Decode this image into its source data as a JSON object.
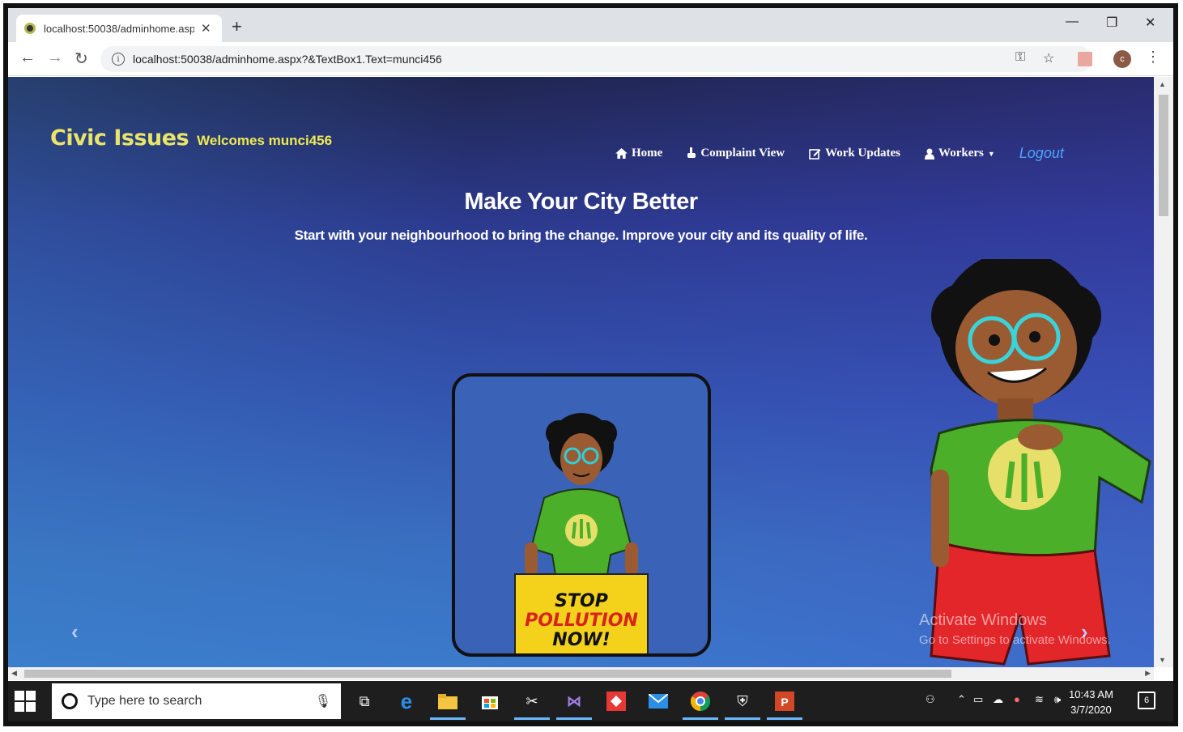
{
  "browser": {
    "tab_title": "localhost:50038/adminhome.aspx",
    "tab_close": "✕",
    "new_tab": "+",
    "url": "localhost:50038/adminhome.aspx?&TextBox1.Text=munci456",
    "profile_initial": "c",
    "window_controls": [
      "—",
      "❐",
      "✕"
    ],
    "nav": {
      "back": "←",
      "forward": "→",
      "reload": "↻"
    }
  },
  "page": {
    "brand_logo": "Civic Issues",
    "brand_welcome": "Welcomes munci456",
    "nav": {
      "home": "Home",
      "complaint_view": "Complaint View",
      "work_updates": "Work Updates",
      "workers": "Workers",
      "logout": "Logout"
    },
    "hero_title": "Make Your City Better",
    "hero_subtitle": "Start with your neighbourhood to bring the change. Improve your city and its quality of life.",
    "sign_line1": "STOP",
    "sign_line2": "POLLUTION",
    "sign_line3": "NOW!",
    "carousel_prev": "‹",
    "carousel_next": "›",
    "watermark_title": "Activate Windows",
    "watermark_sub": "Go to Settings to activate Windows."
  },
  "taskbar": {
    "search_placeholder": "Type here to search",
    "time": "10:43 AM",
    "date": "3/7/2020",
    "notification_count": "6"
  },
  "colors": {
    "brand_yellow": "#f0ea52",
    "logout_blue": "#4da3ff",
    "shirt_green": "#4caf2a",
    "shorts_red": "#e3262a"
  }
}
